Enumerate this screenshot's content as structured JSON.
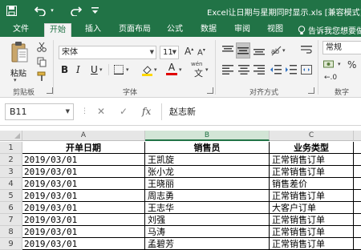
{
  "titlebar": {
    "window_title": "Excel让日期与星期同时显示.xls [兼容模式] -",
    "icons": [
      "save-icon",
      "undo-icon",
      "redo-icon",
      "customize-qat-icon"
    ]
  },
  "tabs": [
    {
      "label": "文件",
      "active": false
    },
    {
      "label": "开始",
      "active": true
    },
    {
      "label": "插入",
      "active": false
    },
    {
      "label": "页面布局",
      "active": false
    },
    {
      "label": "公式",
      "active": false
    },
    {
      "label": "数据",
      "active": false
    },
    {
      "label": "审阅",
      "active": false
    },
    {
      "label": "视图",
      "active": false
    }
  ],
  "tell_me": "告诉我您想要做",
  "ribbon": {
    "clipboard": {
      "paste_label": "粘贴",
      "group_label": "剪贴板"
    },
    "font": {
      "font_name": "宋体",
      "font_size": "11",
      "group_label": "字体",
      "bold": "B",
      "italic": "I",
      "underline": "U",
      "grow": "A",
      "shrink": "A",
      "font_color_letter": "A",
      "wen": "wén"
    },
    "alignment": {
      "group_label": "对齐方式"
    },
    "number": {
      "format": "常规",
      "group_label": "数字"
    }
  },
  "formula_bar": {
    "name_box": "B11",
    "cancel": "✕",
    "enter": "✓",
    "fx": "fx",
    "content": "赵志新"
  },
  "sheet": {
    "columns": [
      "A",
      "B",
      "C"
    ],
    "selected_column": "B",
    "headers": [
      "开单日期",
      "销售员",
      "业务类型"
    ],
    "rows": [
      {
        "n": "1"
      },
      {
        "n": "2",
        "date": "2019/03/01",
        "person": "王凯旋",
        "type": "正常销售订单"
      },
      {
        "n": "3",
        "date": "2019/03/01",
        "person": "张小龙",
        "type": "正常销售订单"
      },
      {
        "n": "4",
        "date": "2019/03/01",
        "person": "王晓丽",
        "type": "销售差价"
      },
      {
        "n": "5",
        "date": "2019/03/01",
        "person": "周志勇",
        "type": "正常销售订单"
      },
      {
        "n": "6",
        "date": "2019/03/01",
        "person": "王志华",
        "type": "大客户订单"
      },
      {
        "n": "7",
        "date": "2019/03/01",
        "person": "刘强",
        "type": "正常销售订单"
      },
      {
        "n": "8",
        "date": "2019/03/01",
        "person": "马涛",
        "type": "正常销售订单"
      },
      {
        "n": "9",
        "date": "2019/03/01",
        "person": "孟碧芳",
        "type": "正常销售订单"
      }
    ]
  },
  "colors": {
    "accent": "#217346",
    "ribbon_bg": "#f3f3f3",
    "header_bg": "#e6e6e6"
  }
}
